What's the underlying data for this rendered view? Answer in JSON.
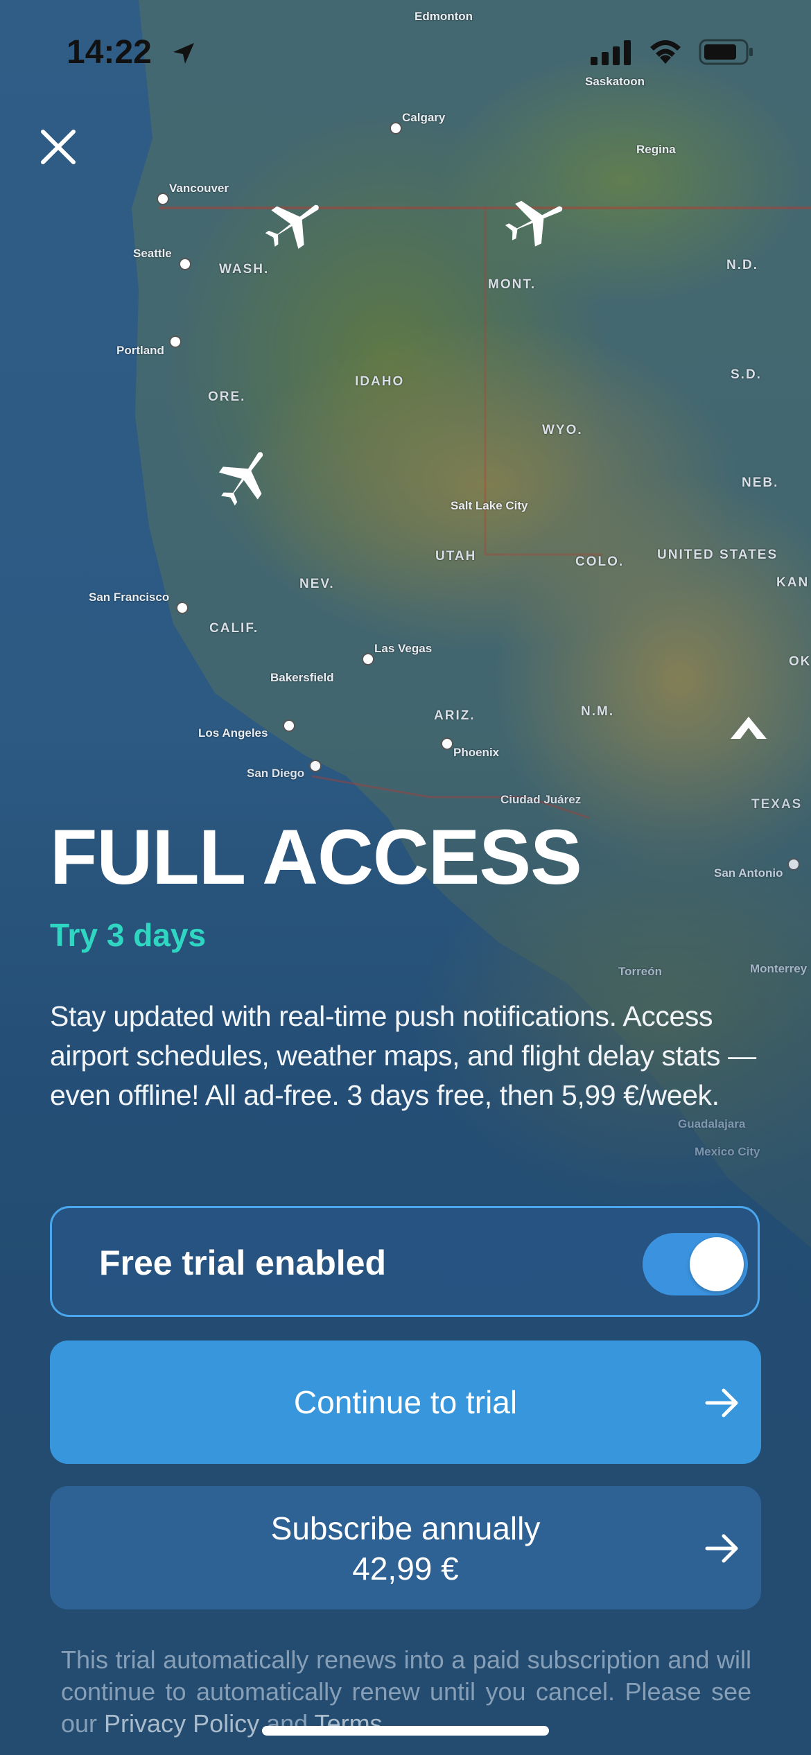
{
  "status_bar": {
    "time": "14:22"
  },
  "map": {
    "labels": {
      "edmonton": "Edmonton",
      "saskatoon": "Saskatoon",
      "calgary": "Calgary",
      "regina": "Regina",
      "vancouver": "Vancouver",
      "seattle": "Seattle",
      "wash": "WASH.",
      "mont": "MONT.",
      "nd": "N.D.",
      "portland": "Portland",
      "sd": "S.D.",
      "idaho": "IDAHO",
      "ore": "ORE.",
      "wyo": "WYO.",
      "neb": "NEB.",
      "salt_lake_city": "Salt Lake City",
      "utah": "UTAH",
      "colo": "COLO.",
      "united_states": "UNITED STATES",
      "kan": "KAN",
      "nev": "NEV.",
      "san_francisco": "San Francisco",
      "calif": "CALIF.",
      "las_vegas": "Las Vegas",
      "ok": "OK",
      "bakersfield": "Bakersfield",
      "ariz": "ARIZ.",
      "nm": "N.M.",
      "los_angeles": "Los Angeles",
      "phoenix": "Phoenix",
      "san_diego": "San Diego",
      "ciudad_juarez": "Ciudad Juárez",
      "texas": "TEXAS",
      "san_antonio": "San Antonio",
      "torreon": "Torreón",
      "monterrey": "Monterrey",
      "guadalajara": "Guadalajara",
      "mexico_city": "Mexico City"
    }
  },
  "paywall": {
    "title": "FULL ACCESS",
    "trial_tagline": "Try 3 days",
    "description": "Stay updated with real-time push notifications. Access airport schedules, weather maps, and flight delay stats — even offline! All ad-free. 3 days free, then 5,99 €/week.",
    "trial_toggle": {
      "label": "Free trial enabled",
      "enabled": true
    },
    "primary_button": {
      "label": "Continue to trial"
    },
    "secondary_button": {
      "label": "Subscribe annually",
      "price": "42,99 €"
    },
    "legal": {
      "text": "This trial automatically renews into a paid subscription and will continue to automatically renew until you cancel. Please see our",
      "privacy_link": "Privacy Policy",
      "and": "and",
      "terms_link": "Terms"
    }
  },
  "colors": {
    "accent": "#3796dc",
    "tagline": "#2fd7c2",
    "toggle_on": "#3b93df"
  },
  "icons": [
    "location-arrow-icon",
    "signal-icon",
    "wifi-icon",
    "battery-icon",
    "close-icon",
    "airplane-icon",
    "arrow-right-icon"
  ]
}
